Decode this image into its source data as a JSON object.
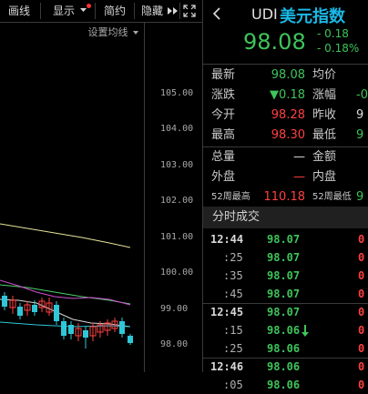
{
  "toolbar": {
    "draw_lines": "画线",
    "display": "显示",
    "simplified": "简约",
    "hide": "隐藏"
  },
  "chart": {
    "ma_setting": "设置均线",
    "price_ticks": [
      "105.00",
      "104.00",
      "103.00",
      "102.00",
      "101.00",
      "100.00",
      "99.00",
      "98.00"
    ]
  },
  "header": {
    "code": "UDI",
    "name": "美元指数",
    "price": "98.08",
    "change": "- 0.18",
    "change_pct": "- 0.18%"
  },
  "quote": {
    "latest_label": "最新",
    "latest_value": "98.08",
    "avg_label": "均价",
    "avg_value": "",
    "change_label": "涨跌",
    "change_value": "▼0.18",
    "change_pct_label": "涨幅",
    "change_pct_value": "-0",
    "open_label": "今开",
    "open_value": "98.28",
    "prev_close_label": "昨收",
    "prev_close_value": "9",
    "high_label": "最高",
    "high_value": "98.30",
    "low_label": "最低",
    "low_value": "9",
    "total_vol_label": "总量",
    "total_vol_value": "—",
    "amount_label": "金额",
    "amount_value": "",
    "outer_label": "外盘",
    "outer_value": "—",
    "inner_label": "内盘",
    "inner_value": "",
    "week52_high_label": "52周最高",
    "week52_high_value": "110.18",
    "week52_low_label": "52周最低",
    "week52_low_value": "9"
  },
  "ticks": {
    "title": "分时成交",
    "rows": [
      {
        "time": "12:44",
        "price": "98.07",
        "vol": "0",
        "sub": false
      },
      {
        "time": ":25",
        "price": "98.07",
        "vol": "0",
        "sub": true
      },
      {
        "time": ":35",
        "price": "98.07",
        "vol": "0",
        "sub": true
      },
      {
        "time": ":45",
        "price": "98.07",
        "vol": "0",
        "sub": true
      },
      {
        "time": "12:45",
        "price": "98.07",
        "vol": "0",
        "sub": false
      },
      {
        "time": ":15",
        "price": "98.06",
        "vol": "0",
        "sub": true
      },
      {
        "time": ":25",
        "price": "98.06",
        "vol": "0",
        "sub": true
      },
      {
        "time": "12:46",
        "price": "98.06",
        "vol": "0",
        "sub": false
      },
      {
        "time": ":05",
        "price": "98.06",
        "vol": "0",
        "sub": true
      }
    ]
  },
  "colors": {
    "up": "#ff4040",
    "down": "#3ec45a",
    "name": "#19b8e6"
  }
}
